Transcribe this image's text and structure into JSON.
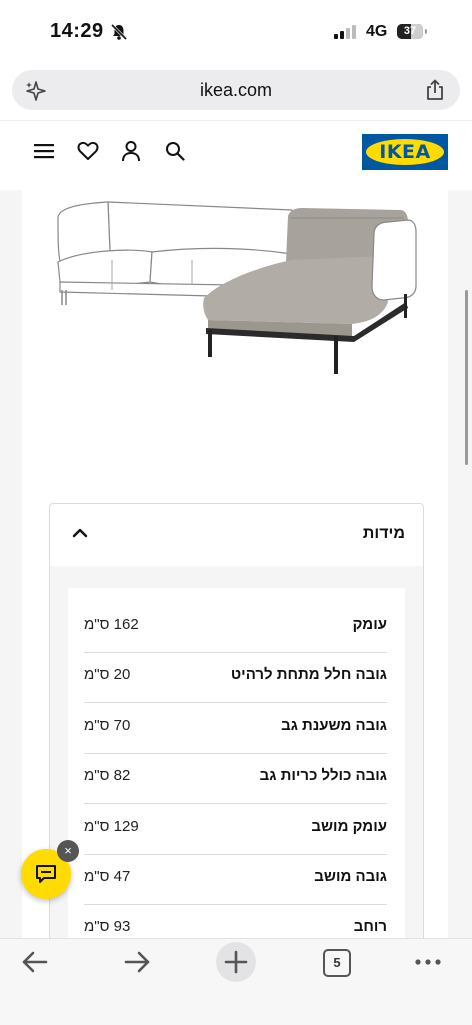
{
  "status_bar": {
    "time": "14:29",
    "network": "4G",
    "battery": "37"
  },
  "browser": {
    "url": "ikea.com",
    "tabs_count": "5"
  },
  "brand": {
    "logo_text": "IKEA",
    "blue": "#0058a3",
    "yellow": "#ffdb00"
  },
  "header_icons": [
    "menu-icon",
    "heart-icon",
    "account-icon",
    "search-icon"
  ],
  "dimensions": {
    "title": "מידות",
    "rows": [
      {
        "label": "עומק",
        "value": "162 ס\"מ"
      },
      {
        "label": "גובה חלל מתחת לרהיט",
        "value": "20 ס\"מ"
      },
      {
        "label": "גובה משענת גב",
        "value": "70 ס\"מ"
      },
      {
        "label": "גובה כולל כריות גב",
        "value": "82 ס\"מ"
      },
      {
        "label": "עומק מושב",
        "value": "129 ס\"מ"
      },
      {
        "label": "גובה מושב",
        "value": "47 ס\"מ"
      },
      {
        "label": "רוחב",
        "value": "93 ס\"מ"
      }
    ]
  },
  "chat": {
    "close_label": "×"
  }
}
